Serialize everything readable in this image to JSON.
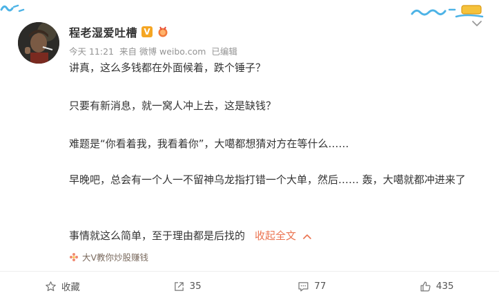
{
  "post": {
    "author": "程老湿爱吐槽",
    "verified_badge": "V",
    "time": "今天 11:21",
    "source_prefix": "来自",
    "source": "微博 weibo.com",
    "edited": "已编辑",
    "paragraphs": [
      "讲真，这么多钱都在外面候着，跌个锤子？",
      "只要有新消息，就一窝人冲上去，这是缺钱？",
      "难题是“你看着我，我看着你”，大噶都想猜对方在等什么……",
      "早晚吧，总会有一个人一不留神乌龙指打错一个大单，然后…… 轰，大噶就都冲进来了",
      "事情就这么简单，至于理由都是后找的"
    ],
    "collapse_label": "收起全文",
    "topic_tag": "大V教你炒股赚钱"
  },
  "actions": {
    "favorite_label": "收藏",
    "repost_count": "35",
    "comment_count": "77",
    "like_count": "435"
  },
  "colors": {
    "accent": "#eb7350",
    "badge": "#f5a623",
    "meta": "#939393"
  },
  "icons": [
    "chevron-down-icon",
    "verified-v-icon",
    "medal-icon",
    "star-icon",
    "repost-icon",
    "comment-icon",
    "like-icon",
    "topic-flower-icon",
    "chevron-up-icon"
  ]
}
